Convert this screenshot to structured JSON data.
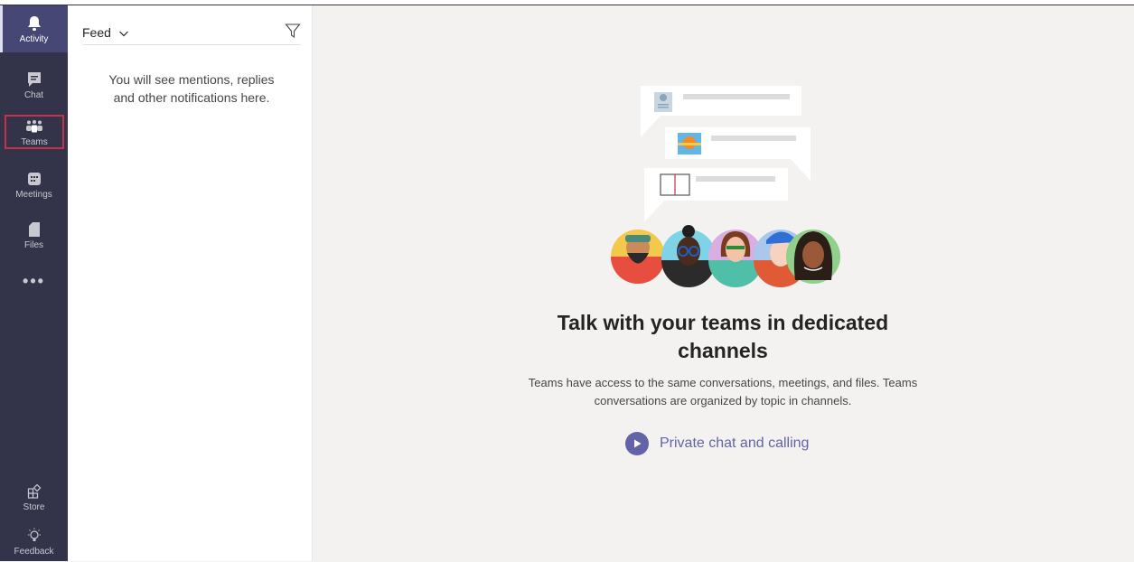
{
  "rail": {
    "items": [
      {
        "label": "Activity",
        "icon": "bell-icon"
      },
      {
        "label": "Chat",
        "icon": "chat-icon"
      },
      {
        "label": "Teams",
        "icon": "teams-icon"
      },
      {
        "label": "Meetings",
        "icon": "calendar-icon"
      },
      {
        "label": "Files",
        "icon": "file-icon"
      }
    ],
    "more": "•••",
    "bottom": [
      {
        "label": "Store",
        "icon": "store-icon"
      },
      {
        "label": "Feedback",
        "icon": "lightbulb-icon"
      }
    ]
  },
  "feed": {
    "title": "Feed",
    "empty_line1": "You will see mentions, replies",
    "empty_line2": "and other notifications here."
  },
  "main": {
    "headline_line1": "Talk with your teams in dedicated",
    "headline_line2": "channels",
    "subtext_line1": "Teams have access to the same conversations, meetings, and files. Teams",
    "subtext_line2": "conversations are organized by topic in channels.",
    "cta_label": "Private chat and calling"
  },
  "colors": {
    "rail_bg": "#33344a",
    "accent": "#6264a7",
    "content_bg": "#f3f2f1",
    "selection_outline": "#c4314b"
  }
}
